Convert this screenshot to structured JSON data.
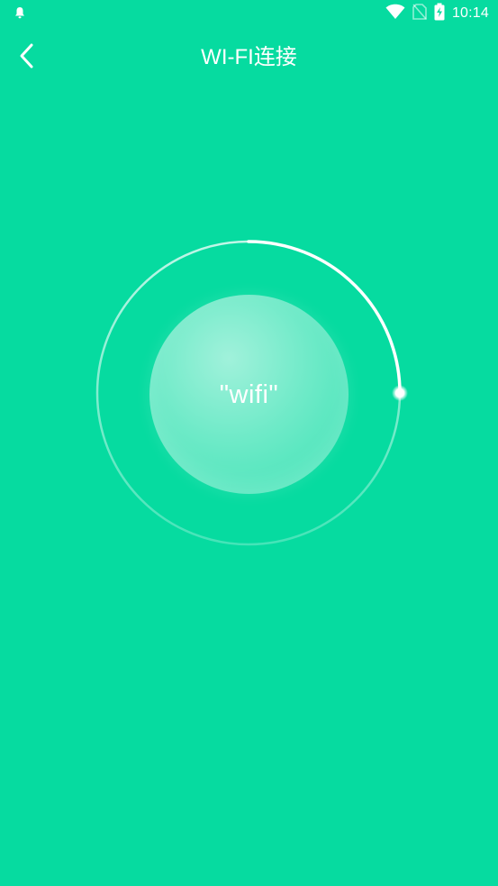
{
  "status_bar": {
    "time": "10:14",
    "left_icon": "notification-bell-icon",
    "right_icons": [
      "wifi-signal-icon",
      "no-sim-icon",
      "battery-charging-icon"
    ]
  },
  "header": {
    "title": "WI-FI连接",
    "back_icon": "back-arrow-icon"
  },
  "connection": {
    "network_name": "\"wifi\"",
    "progress": 0.25
  },
  "colors": {
    "background": "#06dba0",
    "foreground": "#ffffff"
  }
}
